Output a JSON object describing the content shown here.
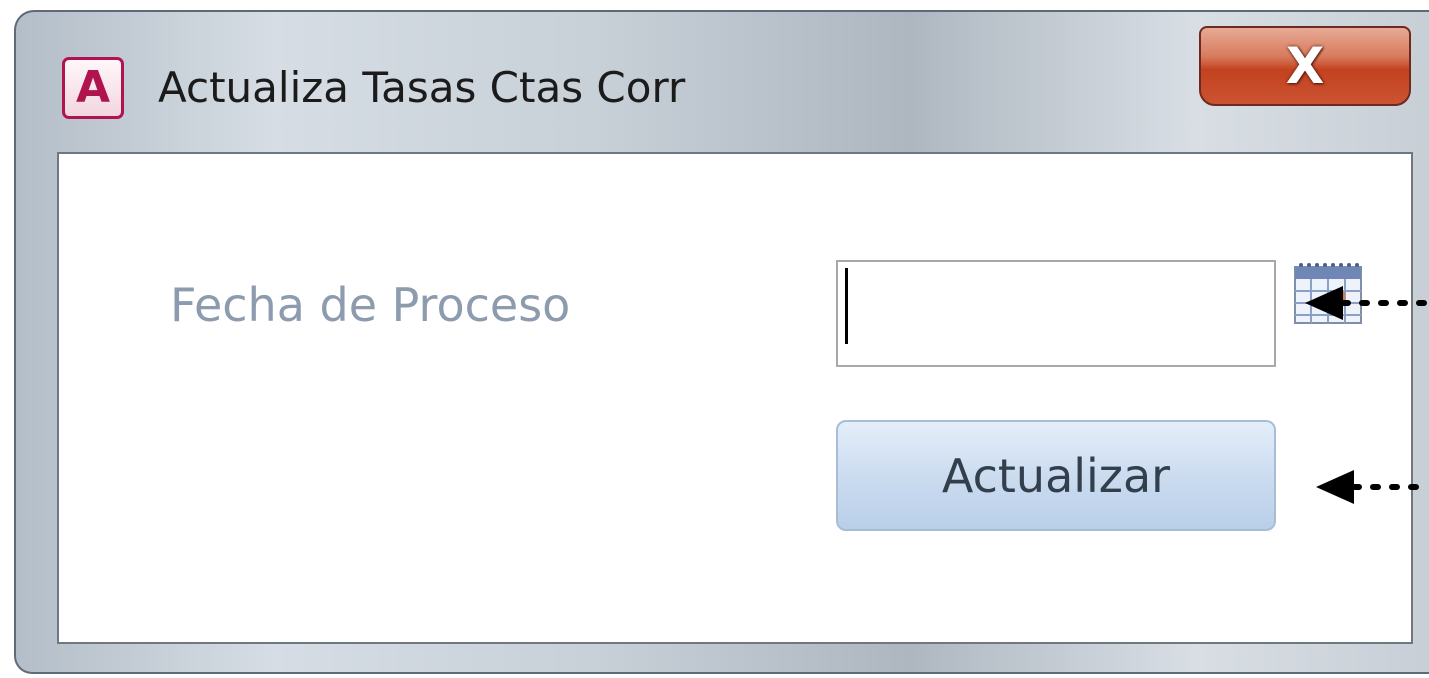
{
  "window": {
    "title": "Actualiza Tasas Ctas Corr",
    "app_icon_letter": "A",
    "close_symbol": "X"
  },
  "form": {
    "date_label": "Fecha de Proceso",
    "date_value": "",
    "update_button_label": "Actualizar"
  },
  "icons": {
    "app": "access-app-icon",
    "close": "close-icon",
    "calendar": "calendar-icon",
    "arrow": "arrow-left-icon"
  },
  "colors": {
    "accent_access": "#b0144f",
    "label_text": "#8c9bae",
    "button_fill": "#ccdcf0",
    "close_red": "#c3421f"
  }
}
